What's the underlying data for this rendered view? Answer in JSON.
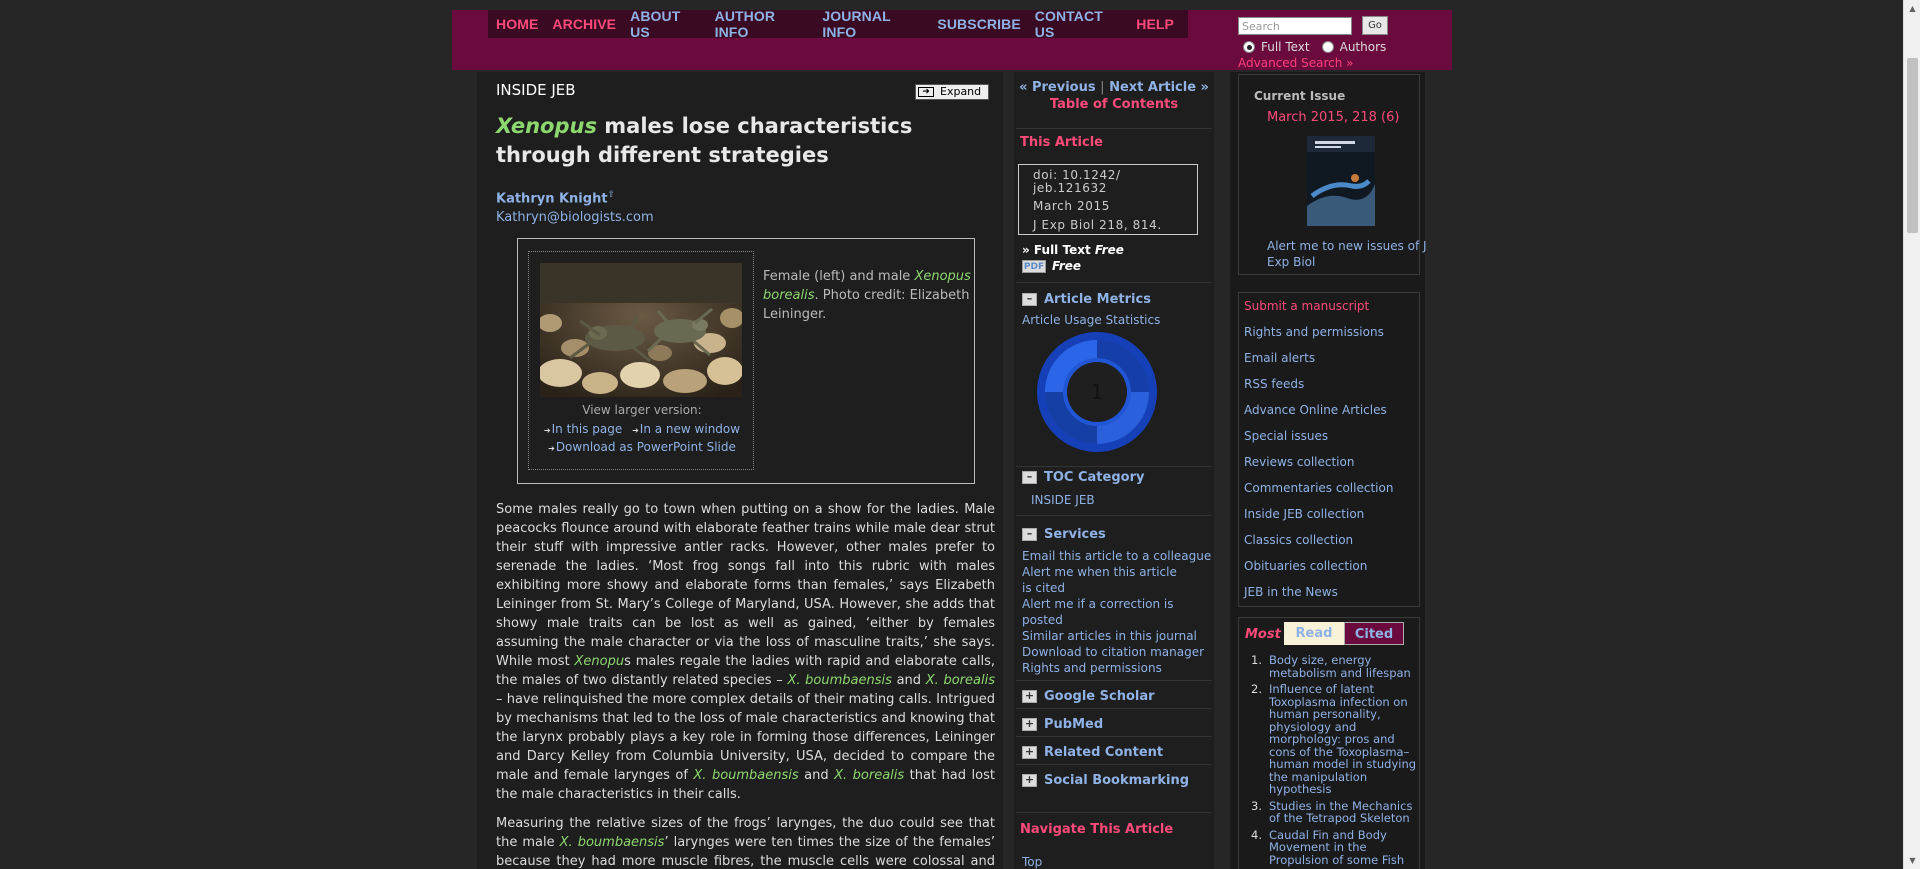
{
  "nav": {
    "items": [
      {
        "label": "HOME",
        "active": true
      },
      {
        "label": "ARCHIVE",
        "active": true
      },
      {
        "label": "ABOUT US",
        "active": false
      },
      {
        "label": "AUTHOR INFO",
        "active": false
      },
      {
        "label": "JOURNAL INFO",
        "active": false
      },
      {
        "label": "SUBSCRIBE",
        "active": false
      },
      {
        "label": "CONTACT US",
        "active": false
      },
      {
        "label": "HELP",
        "active": true
      }
    ]
  },
  "search": {
    "placeholder": "Search",
    "go_label": "Go",
    "option_fulltext": "Full Text",
    "option_authors": "Authors",
    "advanced": "Advanced Search »"
  },
  "article": {
    "section": "INSIDE JEB",
    "expand_label": "Expand",
    "title_italic": "Xenopus",
    "title_rest": " males lose characteristics through different strategies",
    "author": "Kathryn Knight",
    "email": "Kathryn@biologists.com",
    "figure": {
      "caption_pre": "Female (left) and male ",
      "caption_italic": "Xenopus borealis",
      "caption_post": ". Photo credit: Elizabeth Leininger.",
      "view_larger": "View larger version:",
      "link_page": "In this page",
      "link_window": "In a new window",
      "link_ppt": "Download as PowerPoint Slide"
    },
    "paragraphs": [
      [
        {
          "t": "Some males really go to town when putting on a show for the ladies. Male peacocks flounce around with elaborate feather trains while male dear strut their stuff with impressive antler racks. However, other males prefer to serenade the ladies. ‘Most frog songs fall into this rubric with males exhibiting more showy and elaborate forms than females,’ says Elizabeth Leininger from St. Mary’s College of Maryland, USA. However, she adds that showy male traits can be lost as well as gained, ‘either by females assuming the male character or via the loss of masculine traits,’ she says. While most "
        },
        {
          "t": "Xenopu",
          "i": true
        },
        {
          "t": "s males regale the ladies with rapid and elaborate calls, the males of two distantly related species – "
        },
        {
          "t": "X. boumbaensis",
          "i": true
        },
        {
          "t": " and "
        },
        {
          "t": "X. borealis",
          "i": true
        },
        {
          "t": " – have relinquished the more complex details of their mating calls. Intrigued by mechanisms that led to the loss of male characteristics and knowing that the larynx probably plays a key role in forming those differences, Leininger and Darcy Kelley from Columbia University, USA, decided to compare the male and female larynges of "
        },
        {
          "t": "X. boumbaensis",
          "i": true
        },
        {
          "t": " and "
        },
        {
          "t": "X. borealis",
          "i": true
        },
        {
          "t": " that had lost the male characteristics in their calls."
        }
      ],
      [
        {
          "t": "Measuring the relative sizes of the frogs’ larynges, the duo could see that the male "
        },
        {
          "t": "X. boumbaensis",
          "i": true
        },
        {
          "t": "’ larynges were ten times the size of the females’ because they had more muscle fibres, the muscle cells were colossal and they had a"
        }
      ]
    ]
  },
  "midbar": {
    "prev": "« Previous",
    "sep": "|",
    "next": "Next Article »",
    "toc": "Table of Contents",
    "this_article": "This Article",
    "cite_lines": [
      "doi: 10.1242/",
      "jeb.121632",
      "March 2015",
      "J Exp Biol 218, 814."
    ],
    "full_text": "» Full Text",
    "free": "Free",
    "pdf_icon": "PDF",
    "metrics_head": "Article Metrics",
    "usage_stats": "Article Usage Statistics",
    "metrics_value": "1",
    "toc_category_head": "TOC Category",
    "toc_category_value": "INSIDE JEB",
    "services_head": "Services",
    "services": [
      "Email this article to a colleague",
      "Alert me when this article is cited",
      "Alert me if a correction is posted",
      "Similar articles in this journal",
      "Download to citation manager",
      "Rights and permissions"
    ],
    "google_scholar": "Google Scholar",
    "pubmed": "PubMed",
    "related": "Related Content",
    "social": "Social Bookmarking",
    "navigate": "Navigate This Article",
    "top": "Top"
  },
  "rightbar": {
    "current_issue": "Current Issue",
    "issue_link": "March 2015, 218 (6)",
    "alert_issues": "Alert me to new issues of J Exp Biol",
    "links": [
      {
        "label": "Submit a manuscript",
        "red": true
      },
      {
        "label": "Rights and permissions",
        "red": false
      },
      {
        "label": "Email alerts",
        "red": false
      },
      {
        "label": "RSS feeds",
        "red": false
      },
      {
        "label": "Advance Online Articles",
        "red": false
      },
      {
        "label": "Special issues",
        "red": false
      },
      {
        "label": "Reviews collection",
        "red": false
      },
      {
        "label": "Commentaries collection",
        "red": false
      },
      {
        "label": "Inside JEB collection",
        "red": false
      },
      {
        "label": "Classics collection",
        "red": false
      },
      {
        "label": "Obituaries collection",
        "red": false
      },
      {
        "label": "JEB in the News",
        "red": false
      }
    ],
    "most_label": "Most",
    "tab_read": "Read",
    "tab_cited": "Cited",
    "most_list": [
      {
        "n": "1.",
        "title": "Body size, energy metabolism and lifespan"
      },
      {
        "n": "2.",
        "title": "Influence of latent Toxoplasma infection on human personality, physiology and morphology: pros and cons of the Toxoplasma–human model in studying the manipulation hypothesis"
      },
      {
        "n": "3.",
        "title": "Studies in the Mechanics of the Tetrapod Skeleton"
      },
      {
        "n": "4.",
        "title": "Caudal Fin and Body Movement in the Propulsion of some Fish"
      }
    ]
  },
  "colors": {
    "header": "#6b0a3d",
    "link_blue": "#8fb2e6",
    "link_red": "#ff4a7a",
    "species_green": "#8cd76e"
  }
}
